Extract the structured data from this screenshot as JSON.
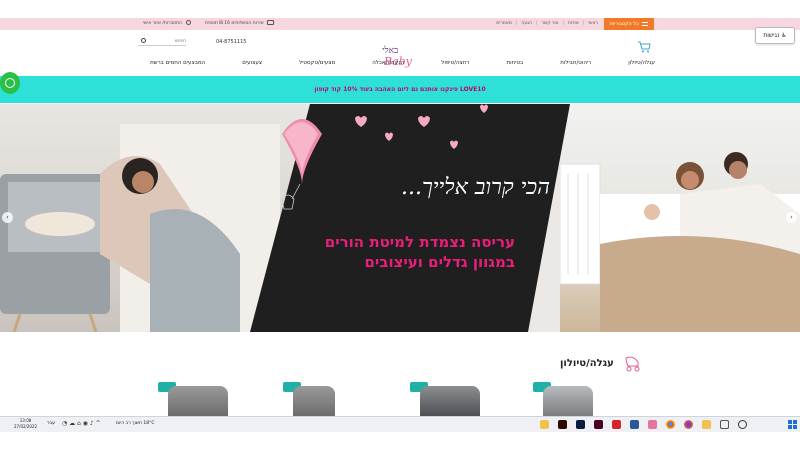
{
  "topbar": {
    "categories_label": "כל הקטגוריות",
    "links": [
      "ראשי",
      "אודות",
      "צור קשר",
      "הגעה",
      "מאמרים"
    ],
    "shipping_text": "שירות המשלוחים 16 ₪ תוספת",
    "login_label": "התחברות/ אזור אישי"
  },
  "accessibility": {
    "label": "נגישות"
  },
  "header": {
    "logo_hebrew": "באלי",
    "logo_english": "Baby",
    "phone": "04-8751115",
    "search_placeholder": "חיפוש"
  },
  "nav": {
    "items": [
      "עגלה/טיולון",
      "ריהוט/חבילות",
      "בטיחות",
      "רחצה/טיפול",
      "הנקה/האכלה",
      "מצעים/טקסטיל",
      "צעצועים",
      "המבצעים החמים ברשת"
    ]
  },
  "promo": {
    "text": "פינקנו אותכם גם ליום האהבה בעוד 10% קוד קופון LOVE10"
  },
  "hero": {
    "title": "הכי קרוב אלייך...",
    "subtitle_line1": "עריסה נצמדת למיטת הורים",
    "subtitle_line2": "במגוון גדלים ועיצובים",
    "prev_icon": "chevron-left-icon",
    "next_icon": "chevron-right-icon"
  },
  "section": {
    "title": "עגלה/טיולון"
  },
  "colors": {
    "topbar_pink": "#f7d7df",
    "category_orange": "#f07a2a",
    "promo_cyan": "#2de1d8",
    "promo_text": "#c4006b",
    "accent_pink": "#e91e7a",
    "whatsapp_green": "#2ac047"
  },
  "taskbar": {
    "clock_time": "13:08",
    "clock_date": "27/02/2022",
    "lang": "עבר",
    "weather": "18°C חשוך רב היום",
    "apps": [
      "files-app-icon",
      "illustrator-icon",
      "photoshop-icon",
      "indesign-icon",
      "acrobat-icon",
      "word-icon",
      "photos-icon",
      "chrome-icon",
      "firefox-icon",
      "explorer-icon",
      "task-view-icon",
      "search-icon",
      "start-icon"
    ]
  }
}
